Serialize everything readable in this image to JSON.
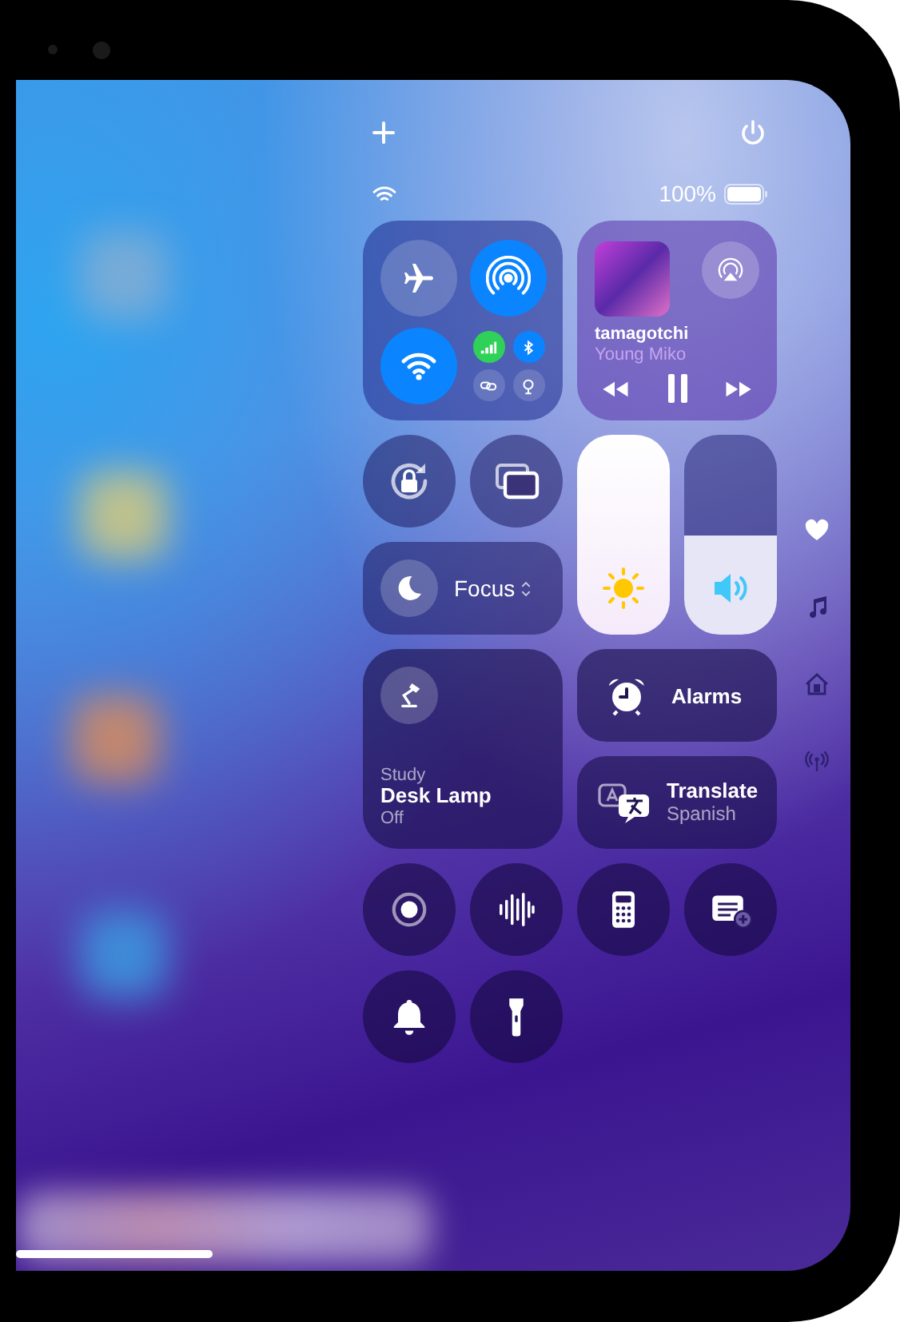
{
  "top_bar": {
    "battery_text": "100%"
  },
  "connectivity": [
    {
      "kind": "airplane",
      "on": false
    },
    {
      "kind": "airdrop",
      "on": true
    },
    {
      "kind": "wifi",
      "on": true
    },
    {
      "kind": "cellular",
      "on": true
    },
    {
      "kind": "bluetooth",
      "on": true
    },
    {
      "kind": "hotspot",
      "on": false
    },
    {
      "kind": "satellite",
      "on": false
    }
  ],
  "now_playing": {
    "title": "tamagotchi",
    "artist": "Young Miko",
    "playing": true
  },
  "brightness": {
    "level": 1
  },
  "volume": {
    "level": 0.5
  },
  "focus": {
    "label": "Focus"
  },
  "home_accessory": {
    "room": "Study",
    "name": "Desk Lamp",
    "status": "Off"
  },
  "alarms": {
    "label": "Alarms"
  },
  "translate": {
    "label": "Translate",
    "language": "Spanish"
  },
  "controls": [
    {
      "kind": "screen-record"
    },
    {
      "kind": "voice-memo"
    },
    {
      "kind": "calculator"
    },
    {
      "kind": "quick-note"
    },
    {
      "kind": "silent-mode"
    },
    {
      "kind": "flashlight"
    }
  ]
}
